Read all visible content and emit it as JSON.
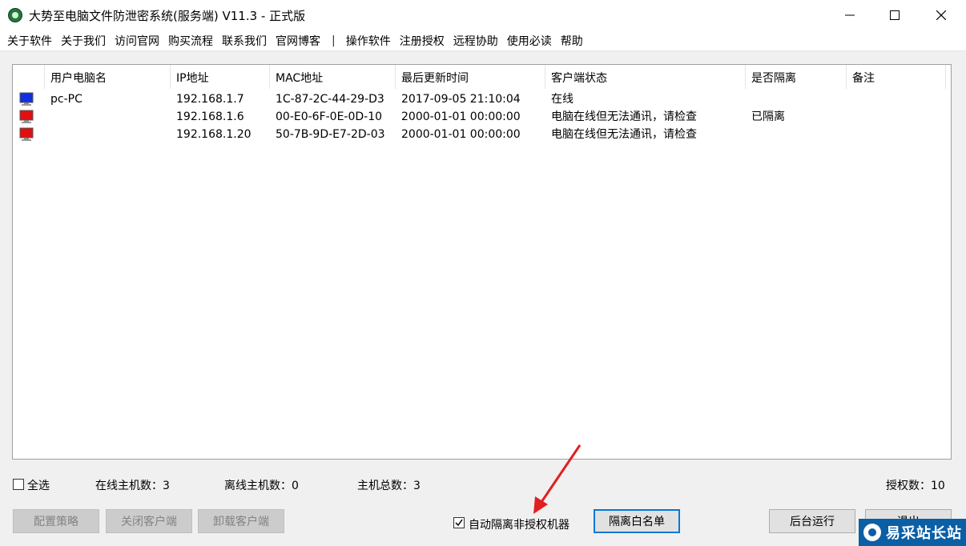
{
  "window": {
    "title": "大势至电脑文件防泄密系统(服务端) V11.3 - 正式版"
  },
  "menu": {
    "items_left": [
      "关于软件",
      "关于我们",
      "访问官网",
      "购买流程",
      "联系我们",
      "官网博客"
    ],
    "separator": "|",
    "items_right": [
      "操作软件",
      "注册授权",
      "远程协助",
      "使用必读",
      "帮助"
    ]
  },
  "table": {
    "columns": [
      "用户电脑名",
      "IP地址",
      "MAC地址",
      "最后更新时间",
      "客户端状态",
      "是否隔离",
      "备注"
    ],
    "rows": [
      {
        "icon": "monitor-blue-icon",
        "name": "pc-PC",
        "ip": "192.168.1.7",
        "mac": "1C-87-2C-44-29-D3",
        "time": "2017-09-05 21:10:04",
        "status": "在线",
        "isolated": "",
        "note": ""
      },
      {
        "icon": "monitor-red-icon",
        "name": "",
        "ip": "192.168.1.6",
        "mac": "00-E0-6F-0E-0D-10",
        "time": "2000-01-01 00:00:00",
        "status": "电脑在线但无法通讯，请检查",
        "isolated": "已隔离",
        "note": ""
      },
      {
        "icon": "monitor-red-icon",
        "name": "",
        "ip": "192.168.1.20",
        "mac": "50-7B-9D-E7-2D-03",
        "time": "2000-01-01 00:00:00",
        "status": "电脑在线但无法通讯，请检查",
        "isolated": "",
        "note": ""
      }
    ]
  },
  "footer": {
    "select_all": "全选",
    "online_count": "在线主机数：3",
    "offline_count": "离线主机数：0",
    "total_count": "主机总数：3",
    "license_count": "授权数：10"
  },
  "buttons": {
    "config_policy": "配置策略",
    "close_client": "关闭客户端",
    "uninstall_client": "卸载客户端",
    "auto_isolate": "自动隔离非授权机器",
    "isolation_whitelist": "隔离白名单",
    "run_background": "后台运行",
    "exit": "退出"
  },
  "watermark": {
    "text": "易采站长站"
  },
  "colors": {
    "blue_monitor": "#1030e0",
    "red_monitor": "#e01010",
    "focus_border": "#0078d7"
  }
}
